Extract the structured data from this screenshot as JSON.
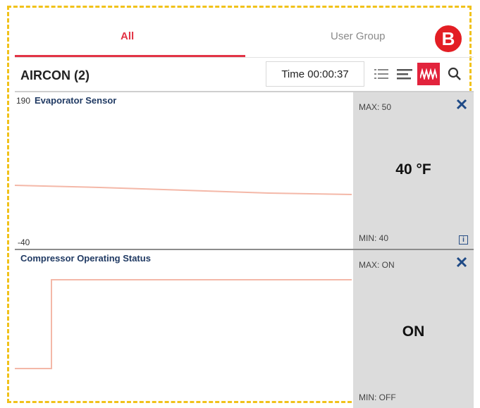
{
  "tabs": [
    {
      "label": "All",
      "active": true
    },
    {
      "label": "User Group",
      "active": false
    }
  ],
  "badge": "B",
  "header": {
    "title": "AIRCON (2)",
    "time": "Time 00:00:37"
  },
  "toolbar": {
    "icons": [
      "list-icon",
      "align-icon",
      "graph-icon",
      "search-icon"
    ],
    "active_color": "#e2233c"
  },
  "panels": [
    {
      "name": "Evaporator Sensor",
      "y_max": "190",
      "y_min": "-40",
      "max": "MAX: 50",
      "min": "MIN: 40",
      "value": "40 °F",
      "line_color": "#f4b8a8"
    },
    {
      "name": "Compressor Operating Status",
      "max": "MAX: ON",
      "min": "MIN: OFF",
      "value": "ON",
      "line_color": "#f4b8a8"
    }
  ],
  "colors": {
    "accent": "#e23345",
    "frame": "#f1c21b",
    "close": "#1f4a86"
  }
}
